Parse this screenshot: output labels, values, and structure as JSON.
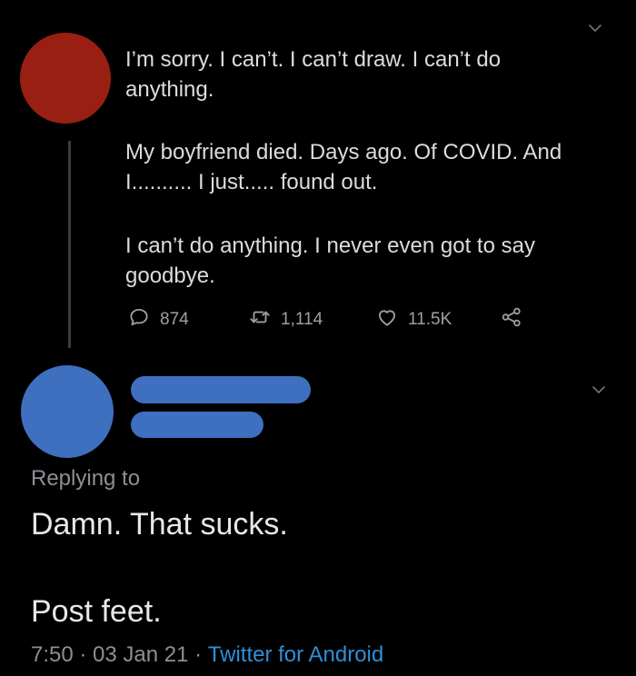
{
  "tweet1": {
    "paragraphs": [
      "I’m sorry. I can’t. I can’t draw. I can’t do\nanything.",
      "My boyfriend died. Days ago. Of COVID. And\nI.......... I just..... found out.",
      "I can’t do anything. I never even got to say\ngoodbye."
    ],
    "avatar_color": "#9a1f13",
    "actions": {
      "replies": "874",
      "retweets": "1,114",
      "likes": "11.5K"
    },
    "icons": [
      "chevron-down-icon",
      "reply-icon",
      "retweet-icon",
      "heart-icon",
      "share-icon"
    ]
  },
  "tweet2": {
    "avatar_color": "#3f6fbf",
    "replying_to": "Replying to",
    "text_line1": "Damn. That sucks.",
    "text_line2": "Post feet.",
    "time": "7:50",
    "date": "03 Jan 21",
    "separator": " · ",
    "source": "Twitter for Android",
    "source_color": "#2f8fd8"
  }
}
